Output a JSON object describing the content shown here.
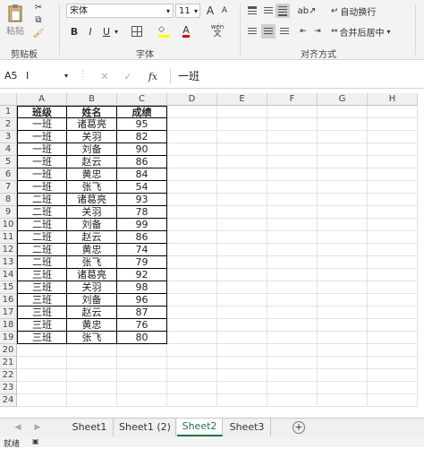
{
  "ribbon": {
    "clipboard": {
      "paste_label": "粘贴",
      "group_label": "剪贴板"
    },
    "font": {
      "font_name": "宋体",
      "font_size": "11",
      "bold": "B",
      "italic": "I",
      "underline": "U",
      "group_label": "字体",
      "grow": "A",
      "shrink": "A",
      "wen": "wén"
    },
    "alignment": {
      "wrap_label": "自动换行",
      "merge_label": "合并后居中",
      "group_label": "对齐方式"
    }
  },
  "formula_bar": {
    "name_box": "A5",
    "content": "一班",
    "fx": "fx"
  },
  "columns": [
    "A",
    "B",
    "C",
    "D",
    "E",
    "F",
    "G",
    "H"
  ],
  "rows": [
    "1",
    "2",
    "3",
    "4",
    "5",
    "6",
    "7",
    "8",
    "9",
    "10",
    "11",
    "12",
    "13",
    "14",
    "15",
    "16",
    "17",
    "18",
    "19",
    "20",
    "21",
    "22",
    "23",
    "24"
  ],
  "table": [
    [
      "班级",
      "姓名",
      "成绩"
    ],
    [
      "一班",
      "诸葛亮",
      "95"
    ],
    [
      "一班",
      "关羽",
      "82"
    ],
    [
      "一班",
      "刘备",
      "90"
    ],
    [
      "一班",
      "赵云",
      "86"
    ],
    [
      "一班",
      "黄忠",
      "84"
    ],
    [
      "一班",
      "张飞",
      "54"
    ],
    [
      "二班",
      "诸葛亮",
      "93"
    ],
    [
      "二班",
      "关羽",
      "78"
    ],
    [
      "二班",
      "刘备",
      "99"
    ],
    [
      "二班",
      "赵云",
      "86"
    ],
    [
      "二班",
      "黄忠",
      "74"
    ],
    [
      "二班",
      "张飞",
      "79"
    ],
    [
      "三班",
      "诸葛亮",
      "92"
    ],
    [
      "三班",
      "关羽",
      "98"
    ],
    [
      "三班",
      "刘备",
      "96"
    ],
    [
      "三班",
      "赵云",
      "87"
    ],
    [
      "三班",
      "黄忠",
      "76"
    ],
    [
      "三班",
      "张飞",
      "80"
    ]
  ],
  "sheets": [
    "Sheet1",
    "Sheet1 (2)",
    "Sheet2",
    "Sheet3"
  ],
  "active_sheet": "Sheet2",
  "status": {
    "ready": "就绪"
  },
  "colors": {
    "accent": "#217346"
  }
}
